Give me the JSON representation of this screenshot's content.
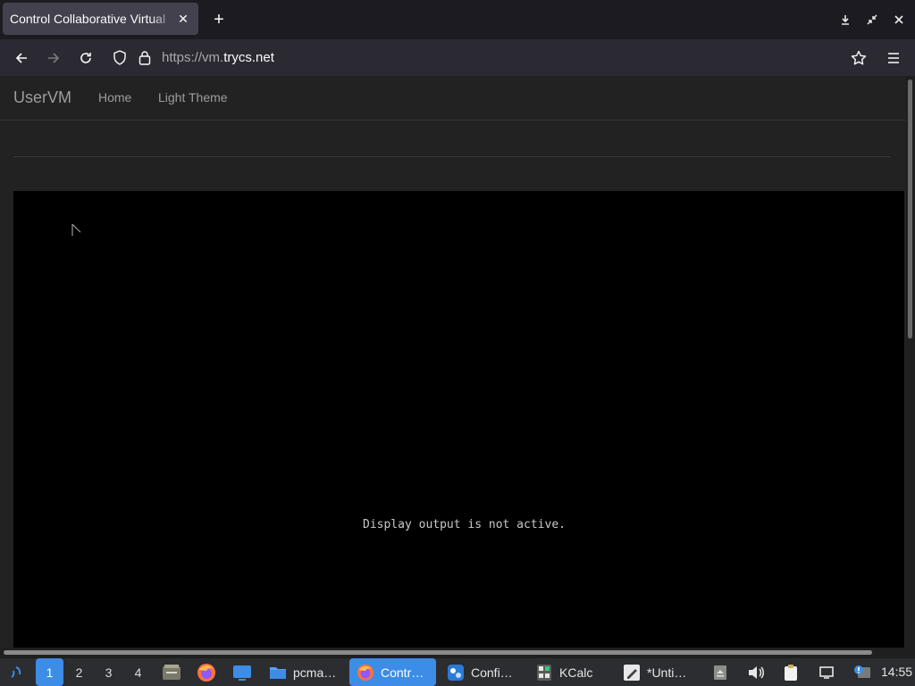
{
  "browser": {
    "tab_title": "Control Collaborative Virtual",
    "url_prefix": "https://vm.",
    "url_domain": "trycs.net"
  },
  "site": {
    "brand": "UserVM",
    "nav": [
      {
        "label": "Home"
      },
      {
        "label": "Light Theme"
      }
    ]
  },
  "vm": {
    "message": "Display output is not active."
  },
  "taskbar": {
    "workspaces": [
      "1",
      "2",
      "3",
      "4"
    ],
    "active_workspace": "1",
    "tasks": [
      {
        "label": "pcma…",
        "icon": "folder-icon"
      },
      {
        "label": "Contr…",
        "icon": "firefox-icon",
        "active": true
      },
      {
        "label": "Confi…",
        "icon": "settings-app-icon"
      },
      {
        "label": "KCalc",
        "icon": "calculator-icon"
      },
      {
        "label": "*Unti…",
        "icon": "text-editor-icon"
      }
    ],
    "clock": "14:55"
  },
  "colors": {
    "accent": "#3d8de6",
    "page_bg": "#222222",
    "vm_bg": "#000000"
  }
}
